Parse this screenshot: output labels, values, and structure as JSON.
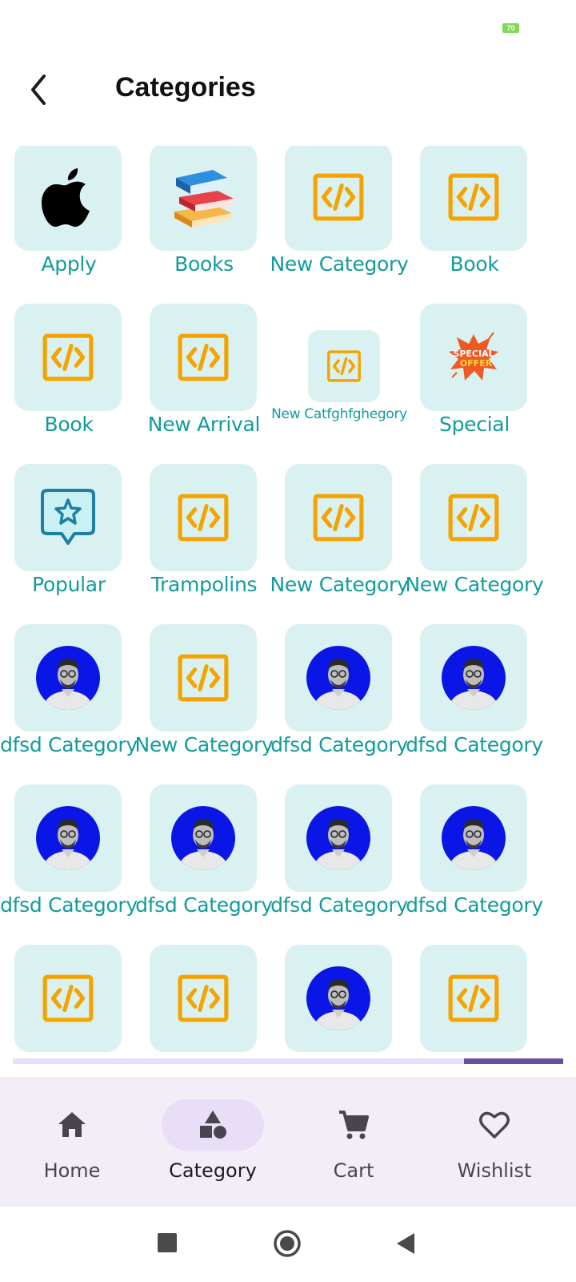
{
  "status_bar": {
    "battery_level": "70"
  },
  "header": {
    "title": "Categories"
  },
  "categories": [
    {
      "label": "Apply",
      "icon": "apple-logo"
    },
    {
      "label": "Books",
      "icon": "books-emoji"
    },
    {
      "label": "New Category",
      "icon": "code-icon"
    },
    {
      "label": "Book",
      "icon": "code-icon"
    },
    {
      "label": "Book",
      "icon": "code-icon"
    },
    {
      "label": "New Arrival",
      "icon": "code-icon"
    },
    {
      "label": "New Catfghfghegory",
      "icon": "code-icon"
    },
    {
      "label": "Special",
      "icon": "special-offer-badge"
    },
    {
      "label": "Popular",
      "icon": "star-chat-icon"
    },
    {
      "label": "Trampolins",
      "icon": "code-icon"
    },
    {
      "label": "New Category",
      "icon": "code-icon"
    },
    {
      "label": "New Category",
      "icon": "code-icon"
    },
    {
      "label": "dfsd Category",
      "icon": "avatar-photo"
    },
    {
      "label": "New Category",
      "icon": "code-icon"
    },
    {
      "label": "dfsd Category",
      "icon": "avatar-photo"
    },
    {
      "label": "dfsd Category",
      "icon": "avatar-photo"
    },
    {
      "label": "dfsd Category",
      "icon": "avatar-photo"
    },
    {
      "label": "dfsd Category",
      "icon": "avatar-photo"
    },
    {
      "label": "dfsd Category",
      "icon": "avatar-photo"
    },
    {
      "label": "dfsd Category",
      "icon": "avatar-photo"
    },
    {
      "label": "",
      "icon": "code-icon"
    },
    {
      "label": "",
      "icon": "code-icon"
    },
    {
      "label": "",
      "icon": "avatar-photo"
    },
    {
      "label": "",
      "icon": "code-icon"
    }
  ],
  "bottom_nav": {
    "items": [
      {
        "label": "Home",
        "icon": "home-icon",
        "active": false
      },
      {
        "label": "Category",
        "icon": "category-shapes-icon",
        "active": true
      },
      {
        "label": "Cart",
        "icon": "cart-icon",
        "active": false
      },
      {
        "label": "Wishlist",
        "icon": "heart-icon",
        "active": false
      }
    ]
  },
  "colors": {
    "tile_bg": "#d9f2f1",
    "label_teal": "#139b9b",
    "code_icon_orange": "#f5a300",
    "nav_bg": "#f3edf7",
    "nav_active_pill": "#e8def8",
    "scroll_thumb": "#6750a4"
  }
}
